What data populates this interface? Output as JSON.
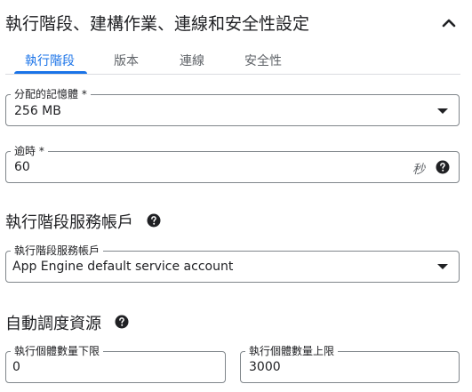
{
  "section": {
    "title": "執行階段、建構作業、連線和安全性設定"
  },
  "tabs": [
    {
      "label": "執行階段",
      "active": true
    },
    {
      "label": "版本",
      "active": false
    },
    {
      "label": "連線",
      "active": false
    },
    {
      "label": "安全性",
      "active": false
    }
  ],
  "memory": {
    "label": "分配的記憶體 *",
    "value": "256 MB"
  },
  "timeout": {
    "label": "逾時 *",
    "value": "60",
    "suffix": "秒"
  },
  "service_account": {
    "heading": "執行階段服務帳戶",
    "label": "執行階段服務帳戶",
    "value": "App Engine default service account"
  },
  "autoscaling": {
    "heading": "自動調度資源",
    "min_label": "執行個體數量下限",
    "min_value": "0",
    "max_label": "執行個體數量上限",
    "max_value": "3000"
  },
  "colors": {
    "accent": "#1a73e8",
    "border": "#80868b",
    "text": "#202124"
  },
  "icons": {
    "collapse": "chevron-up-icon",
    "help": "help-circle-icon",
    "dropdown": "arrow-drop-down-icon"
  }
}
